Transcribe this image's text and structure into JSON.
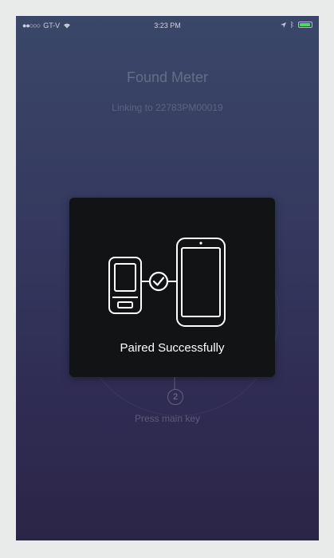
{
  "status_bar": {
    "carrier": "GT-V",
    "time": "3:23 PM"
  },
  "header": {
    "title": "Found Meter",
    "subtitle": "Linking to 22783PM00019"
  },
  "background_step": {
    "number": "2",
    "text": "Press main key"
  },
  "modal": {
    "message": "Paired Successfully",
    "icons": [
      "meter-device-icon",
      "checkmark-circle-icon",
      "phone-icon"
    ]
  },
  "colors": {
    "background_top": "#3a4768",
    "background_bottom": "#2b2547",
    "modal_bg": "#121315",
    "battery": "#4cd964"
  }
}
